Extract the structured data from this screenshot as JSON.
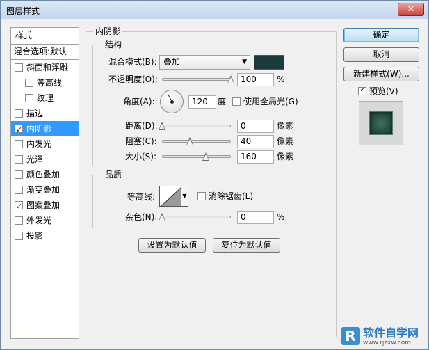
{
  "window": {
    "title": "图层样式",
    "close_glyph": "✕"
  },
  "styles_panel": {
    "header": "样式",
    "blend_options": "混合选项:默认",
    "items": [
      {
        "label": "斜面和浮雕",
        "checked": false,
        "selected": false,
        "indent": false
      },
      {
        "label": "等高线",
        "checked": false,
        "selected": false,
        "indent": true
      },
      {
        "label": "纹理",
        "checked": false,
        "selected": false,
        "indent": true
      },
      {
        "label": "描边",
        "checked": false,
        "selected": false,
        "indent": false
      },
      {
        "label": "内阴影",
        "checked": true,
        "selected": true,
        "indent": false
      },
      {
        "label": "内发光",
        "checked": false,
        "selected": false,
        "indent": false
      },
      {
        "label": "光泽",
        "checked": false,
        "selected": false,
        "indent": false
      },
      {
        "label": "颜色叠加",
        "checked": false,
        "selected": false,
        "indent": false
      },
      {
        "label": "渐变叠加",
        "checked": false,
        "selected": false,
        "indent": false
      },
      {
        "label": "图案叠加",
        "checked": true,
        "selected": false,
        "indent": false
      },
      {
        "label": "外发光",
        "checked": false,
        "selected": false,
        "indent": false
      },
      {
        "label": "投影",
        "checked": false,
        "selected": false,
        "indent": false
      }
    ]
  },
  "inner_shadow": {
    "title": "内阴影",
    "structure": {
      "title": "结构",
      "blend_mode_label": "混合模式(B):",
      "blend_mode_value": "叠加",
      "shadow_color": "#1a3a3c",
      "opacity_label": "不透明度(O):",
      "opacity_value": "100",
      "opacity_fraction": 1.0,
      "percent_unit": "%",
      "angle_label": "角度(A):",
      "angle_value": "120",
      "angle_degrees": 120,
      "angle_unit": "度",
      "global_light_label": "使用全局光(G)",
      "global_light_checked": false,
      "distance_label": "距离(D):",
      "distance_value": "0",
      "distance_fraction": 0.0,
      "choke_label": "阻塞(C):",
      "choke_value": "40",
      "choke_fraction": 0.4,
      "size_label": "大小(S):",
      "size_value": "160",
      "size_fraction": 0.64,
      "pixel_unit": "像素"
    },
    "quality": {
      "title": "品质",
      "contour_label": "等高线:",
      "anti_alias_label": "消除锯齿(L)",
      "anti_alias_checked": false,
      "noise_label": "杂色(N):",
      "noise_value": "0",
      "noise_fraction": 0.0,
      "percent_unit": "%"
    },
    "make_default": "设置为默认值",
    "reset_default": "复位为默认值"
  },
  "buttons": {
    "ok": "确定",
    "cancel": "取消",
    "new_style": "新建样式(W)...",
    "preview_label": "预览(V)",
    "preview_checked": true
  },
  "watermark": {
    "logo": "R",
    "name": "软件自学网",
    "url": "www.rjzxw.com"
  }
}
